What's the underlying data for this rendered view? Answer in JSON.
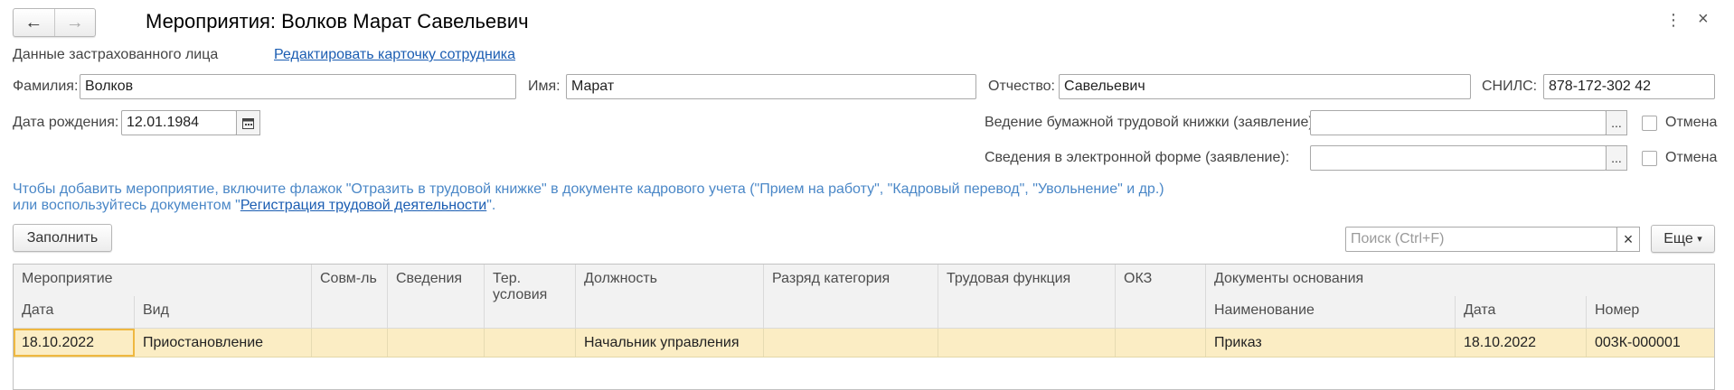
{
  "window": {
    "title": "Мероприятия: Волков Марат Савельевич",
    "back_icon": "←",
    "forward_icon": "→",
    "more_icon": "⋮",
    "close_icon": "×"
  },
  "insured": {
    "section_label": "Данные застрахованного лица",
    "edit_link": "Редактировать карточку сотрудника",
    "surname_label": "Фамилия:",
    "surname": "Волков",
    "name_label": "Имя:",
    "name": "Марат",
    "patronymic_label": "Отчество:",
    "patronymic": "Савельевич",
    "snils_label": "СНИЛС:",
    "snils": "878-172-302 42",
    "birth_label": "Дата рождения:",
    "birth": "12.01.1984",
    "calendar_icon": "calendar-icon"
  },
  "statements": {
    "paper_label": "Ведение бумажной трудовой книжки (заявление):",
    "paper_value": "",
    "electronic_label": "Сведения в электронной форме (заявление):",
    "electronic_value": "",
    "select_glyph": "...",
    "cancel_label": "Отмена"
  },
  "info": {
    "line1": "Чтобы добавить мероприятие, включите флажок \"Отразить в трудовой книжке\" в документе кадрового учета (\"Прием на работу\", \"Кадровый перевод\", \"Увольнение\" и др.)",
    "line2_prefix": "или воспользуйтесь документом \"",
    "line2_link": "Регистрация трудовой деятельности",
    "line2_suffix": "\"."
  },
  "toolbar": {
    "fill_button": "Заполнить",
    "search_placeholder": "Поиск (Ctrl+F)",
    "search_clear": "×",
    "more_button": "Еще",
    "more_arrow": "▾"
  },
  "table": {
    "headers": {
      "event": "Мероприятие",
      "date": "Дата",
      "kind": "Вид",
      "combo": "Совм-ль",
      "info": "Сведения",
      "terr": "Тер. условия",
      "position": "Должность",
      "grade": "Разряд категория",
      "function": "Трудовая функция",
      "okz": "ОКЗ",
      "docs": "Документы основания",
      "doc_name": "Наименование",
      "doc_date": "Дата",
      "doc_number": "Номер"
    },
    "rows": [
      {
        "date": "18.10.2022",
        "kind": "Приостановление",
        "combo": "",
        "info": "",
        "terr": "",
        "position": "Начальник управления",
        "grade": "",
        "function": "",
        "okz": "",
        "doc_name": "Приказ",
        "doc_date": "18.10.2022",
        "doc_number": "003К-000001"
      }
    ]
  }
}
